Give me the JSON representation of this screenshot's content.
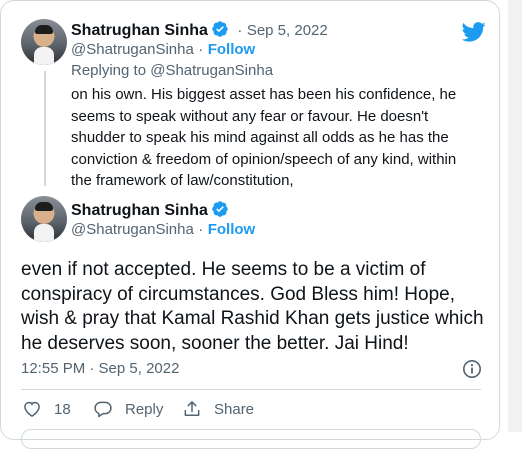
{
  "reply_tweet": {
    "author_name": "Shatrughan Sinha",
    "separator": "·",
    "date": "Sep 5, 2022",
    "handle": "@ShatruganSinha",
    "follow_sep": "·",
    "follow_label": "Follow",
    "replying_prefix": "Replying to ",
    "replying_handle": "@ShatruganSinha",
    "text": "on his own. His biggest asset has been his confidence, he seems to speak without any fear or favour. He doesn't shudder to speak his mind against all odds as he has the conviction & freedom of opinion/speech of any kind, within the framework of law/constitution,"
  },
  "main_tweet": {
    "author_name": "Shatrughan Sinha",
    "handle": "@ShatruganSinha",
    "follow_sep": "·",
    "follow_label": "Follow",
    "text": "even if not accepted. He seems to be a victim of conspiracy of circumstances. God Bless him! Hope, wish & pray that Kamal Rashid Khan gets justice which he deserves soon, sooner the better. Jai Hind!",
    "timestamp": "12:55 PM · Sep 5, 2022"
  },
  "actions": {
    "likes_count": "18",
    "reply_label": "Reply",
    "share_label": "Share"
  },
  "icons": {
    "brand": "twitter-bird-icon",
    "verified": "verified-badge-icon",
    "info": "info-icon",
    "like": "heart-icon",
    "reply": "reply-bubble-icon",
    "share": "share-icon"
  },
  "colors": {
    "brand_blue": "#1d9bf0",
    "text_primary": "#0f1419",
    "text_secondary": "#536471",
    "border": "#cfd9de"
  }
}
